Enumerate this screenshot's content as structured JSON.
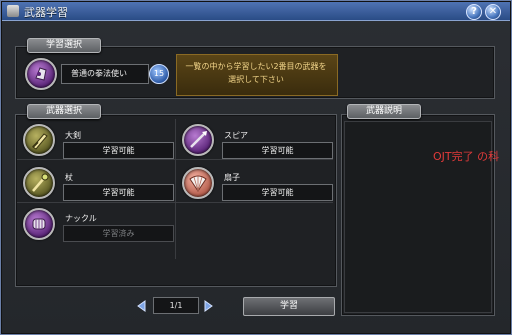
{
  "window": {
    "title": "武器学習",
    "help_label": "?",
    "close_label": "✕"
  },
  "study_select": {
    "label": "学習選択",
    "class_name": "普通の拳法使い",
    "level": "15",
    "instruction": "一覧の中から学習したい2番目の武器を選択して下さい"
  },
  "weapon_select": {
    "label": "武器選択",
    "items": [
      {
        "name": "大剣",
        "status": "学習可能",
        "icon": "great-sword-icon",
        "state": "available"
      },
      {
        "name": "スピア",
        "status": "学習可能",
        "icon": "spear-icon",
        "state": "available"
      },
      {
        "name": "杖",
        "status": "学習可能",
        "icon": "staff-icon",
        "state": "available"
      },
      {
        "name": "扇子",
        "status": "学習可能",
        "icon": "fan-icon",
        "state": "available"
      },
      {
        "name": "ナックル",
        "status": "学習済み",
        "icon": "knuckle-icon",
        "state": "learned"
      }
    ],
    "page": "1/1",
    "learn_button": "学習"
  },
  "weapon_desc": {
    "label": "武器説明"
  },
  "overlay": {
    "text": "OJT完了 の科"
  },
  "colors": {
    "title_bar": "#3f62a2",
    "instruction_bg": "#4b3a14",
    "instruction_text": "#f2d58a",
    "overlay_text": "#e03a3a"
  }
}
